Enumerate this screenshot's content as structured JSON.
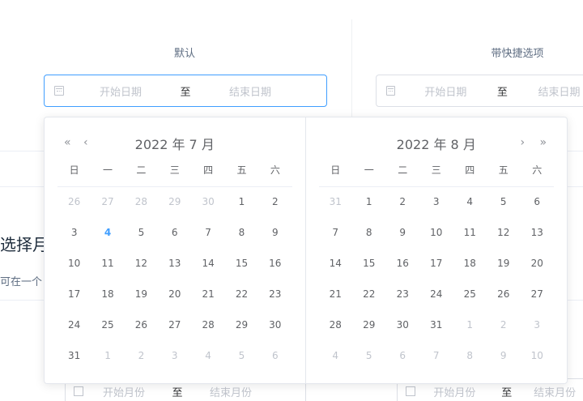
{
  "columns": {
    "left_label": "默认",
    "right_label": "带快捷选项"
  },
  "date_range": {
    "start_placeholder": "开始日期",
    "separator": "至",
    "end_placeholder": "结束日期"
  },
  "section": {
    "title": "选择月",
    "desc": "可在一个"
  },
  "month_range": {
    "start_placeholder": "开始月份",
    "separator": "至",
    "end_placeholder": "结束月份"
  },
  "calendar": {
    "weekdays": [
      "日",
      "一",
      "二",
      "三",
      "四",
      "五",
      "六"
    ],
    "left": {
      "title": "2022 年 7 月",
      "prev_year": "«",
      "prev_month": "‹",
      "days": [
        {
          "d": "26",
          "cls": "other"
        },
        {
          "d": "27",
          "cls": "other"
        },
        {
          "d": "28",
          "cls": "other"
        },
        {
          "d": "29",
          "cls": "other"
        },
        {
          "d": "30",
          "cls": "other"
        },
        {
          "d": "1",
          "cls": ""
        },
        {
          "d": "2",
          "cls": ""
        },
        {
          "d": "3",
          "cls": ""
        },
        {
          "d": "4",
          "cls": "today"
        },
        {
          "d": "5",
          "cls": ""
        },
        {
          "d": "6",
          "cls": ""
        },
        {
          "d": "7",
          "cls": ""
        },
        {
          "d": "8",
          "cls": ""
        },
        {
          "d": "9",
          "cls": ""
        },
        {
          "d": "10",
          "cls": ""
        },
        {
          "d": "11",
          "cls": ""
        },
        {
          "d": "12",
          "cls": ""
        },
        {
          "d": "13",
          "cls": ""
        },
        {
          "d": "14",
          "cls": ""
        },
        {
          "d": "15",
          "cls": ""
        },
        {
          "d": "16",
          "cls": ""
        },
        {
          "d": "17",
          "cls": ""
        },
        {
          "d": "18",
          "cls": ""
        },
        {
          "d": "19",
          "cls": ""
        },
        {
          "d": "20",
          "cls": ""
        },
        {
          "d": "21",
          "cls": ""
        },
        {
          "d": "22",
          "cls": ""
        },
        {
          "d": "23",
          "cls": ""
        },
        {
          "d": "24",
          "cls": ""
        },
        {
          "d": "25",
          "cls": ""
        },
        {
          "d": "26",
          "cls": ""
        },
        {
          "d": "27",
          "cls": ""
        },
        {
          "d": "28",
          "cls": ""
        },
        {
          "d": "29",
          "cls": ""
        },
        {
          "d": "30",
          "cls": ""
        },
        {
          "d": "31",
          "cls": ""
        },
        {
          "d": "1",
          "cls": "other"
        },
        {
          "d": "2",
          "cls": "other"
        },
        {
          "d": "3",
          "cls": "other"
        },
        {
          "d": "4",
          "cls": "other"
        },
        {
          "d": "5",
          "cls": "other"
        },
        {
          "d": "6",
          "cls": "other"
        }
      ]
    },
    "right": {
      "title": "2022 年 8 月",
      "next_month": "›",
      "next_year": "»",
      "days": [
        {
          "d": "31",
          "cls": "other"
        },
        {
          "d": "1",
          "cls": ""
        },
        {
          "d": "2",
          "cls": ""
        },
        {
          "d": "3",
          "cls": ""
        },
        {
          "d": "4",
          "cls": ""
        },
        {
          "d": "5",
          "cls": ""
        },
        {
          "d": "6",
          "cls": ""
        },
        {
          "d": "7",
          "cls": ""
        },
        {
          "d": "8",
          "cls": ""
        },
        {
          "d": "9",
          "cls": ""
        },
        {
          "d": "10",
          "cls": ""
        },
        {
          "d": "11",
          "cls": ""
        },
        {
          "d": "12",
          "cls": ""
        },
        {
          "d": "13",
          "cls": ""
        },
        {
          "d": "14",
          "cls": ""
        },
        {
          "d": "15",
          "cls": ""
        },
        {
          "d": "16",
          "cls": ""
        },
        {
          "d": "17",
          "cls": ""
        },
        {
          "d": "18",
          "cls": ""
        },
        {
          "d": "19",
          "cls": ""
        },
        {
          "d": "20",
          "cls": ""
        },
        {
          "d": "21",
          "cls": ""
        },
        {
          "d": "22",
          "cls": ""
        },
        {
          "d": "23",
          "cls": ""
        },
        {
          "d": "24",
          "cls": ""
        },
        {
          "d": "25",
          "cls": ""
        },
        {
          "d": "26",
          "cls": ""
        },
        {
          "d": "27",
          "cls": ""
        },
        {
          "d": "28",
          "cls": ""
        },
        {
          "d": "29",
          "cls": ""
        },
        {
          "d": "30",
          "cls": ""
        },
        {
          "d": "31",
          "cls": ""
        },
        {
          "d": "1",
          "cls": "other"
        },
        {
          "d": "2",
          "cls": "other"
        },
        {
          "d": "3",
          "cls": "other"
        },
        {
          "d": "4",
          "cls": "other"
        },
        {
          "d": "5",
          "cls": "other"
        },
        {
          "d": "6",
          "cls": "other"
        },
        {
          "d": "7",
          "cls": "other"
        },
        {
          "d": "8",
          "cls": "other"
        },
        {
          "d": "9",
          "cls": "other"
        },
        {
          "d": "10",
          "cls": "other"
        }
      ]
    }
  },
  "colors": {
    "accent": "#409eff",
    "muted": "#c0c4cc",
    "text": "#606266"
  }
}
